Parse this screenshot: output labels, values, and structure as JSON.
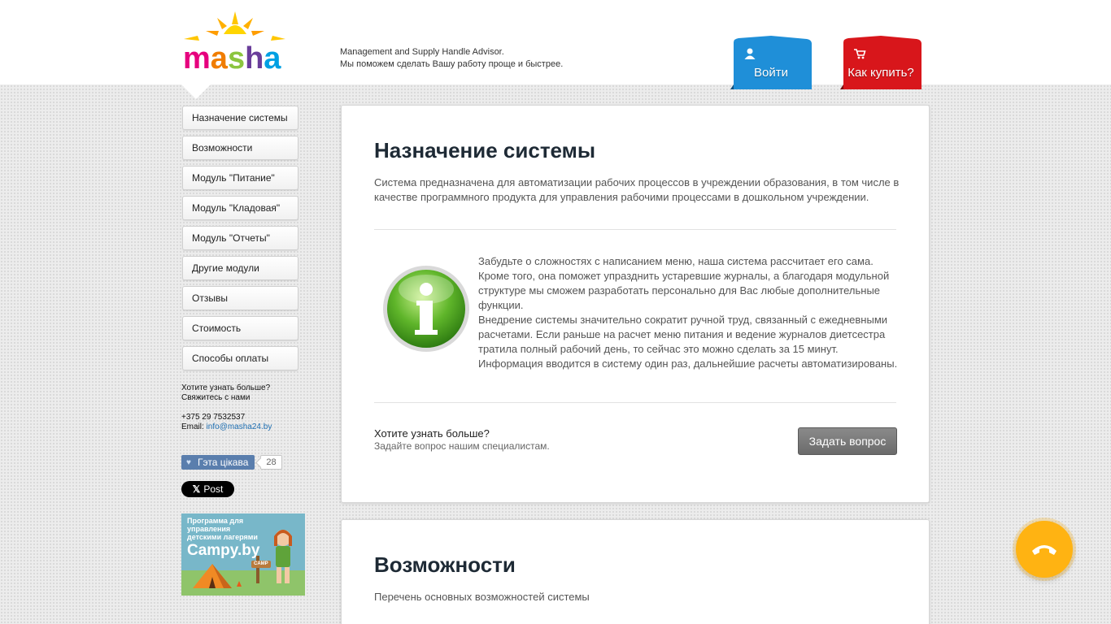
{
  "header": {
    "logo_text": "masha",
    "tagline_line1": "Management and Supply Handle Advisor.",
    "tagline_line2": "Мы поможем сделать Вашу работу проще и быстрее.",
    "login_label": "Войти",
    "buy_label": "Как купить?",
    "login_color": "#1f8fd8",
    "buy_color": "#d8161b"
  },
  "sidebar": {
    "items": [
      {
        "label": "Назначение системы"
      },
      {
        "label": "Возможности"
      },
      {
        "label": "Модуль \"Питание\""
      },
      {
        "label": "Модуль \"Кладовая\""
      },
      {
        "label": "Модуль \"Отчеты\""
      },
      {
        "label": "Другие модули"
      },
      {
        "label": "Отзывы"
      },
      {
        "label": "Стоимость"
      },
      {
        "label": "Способы оплаты"
      }
    ],
    "contact": {
      "line1": "Хотите узнать больше?",
      "line2": "Свяжитесь с нами",
      "phone": "+375 29 7532537",
      "email_label": "Email:",
      "email": "info@masha24.by"
    },
    "like": {
      "label": "Гэта цікава",
      "count": "28"
    },
    "x_post": {
      "label": "Post"
    },
    "banner": {
      "line1": "Программа для",
      "line2": "управления",
      "line3": "детскими лагерями",
      "big": "Campy.by",
      "sign": "CAMP"
    }
  },
  "main": {
    "section1": {
      "title": "Назначение системы",
      "intro": "Система предназначена для автоматизации рабочих процессов в учреждении образования, в том числе в качестве программного продукта для управления рабочими процессами в дошкольном учреждении.",
      "body_p1": "Забудьте о сложностях с написанием меню, наша система рассчитает его сама. Кроме того, она поможет упразднить устаревшие журналы, а благодаря модульной структуре мы сможем разработать персонально для Вас любые дополнительные функции.",
      "body_p2": "Внедрение системы значительно сократит ручной труд, связанный с ежедневными расчетами. Если раньше на расчет меню питания и ведение журналов диетсестра тратила полный рабочий день, то сейчас это можно сделать за 15 минут. Информация вводится в систему один раз, дальнейшие расчеты автоматизированы.",
      "ask_title": "Хотите узнать больше?",
      "ask_sub": "Задайте вопрос нашим специалистам.",
      "ask_button": "Задать вопрос"
    },
    "section2": {
      "title": "Возможности",
      "intro": "Перечень основных возможностей системы"
    }
  },
  "icons": {
    "info": "info-icon",
    "user": "user-icon",
    "cart": "cart-icon",
    "phone": "phone-hangup-icon",
    "heart": "heart-icon"
  },
  "colors": {
    "accent_call": "#ffb312",
    "like_button": "#5a7ead",
    "link": "#1f6fb2"
  }
}
